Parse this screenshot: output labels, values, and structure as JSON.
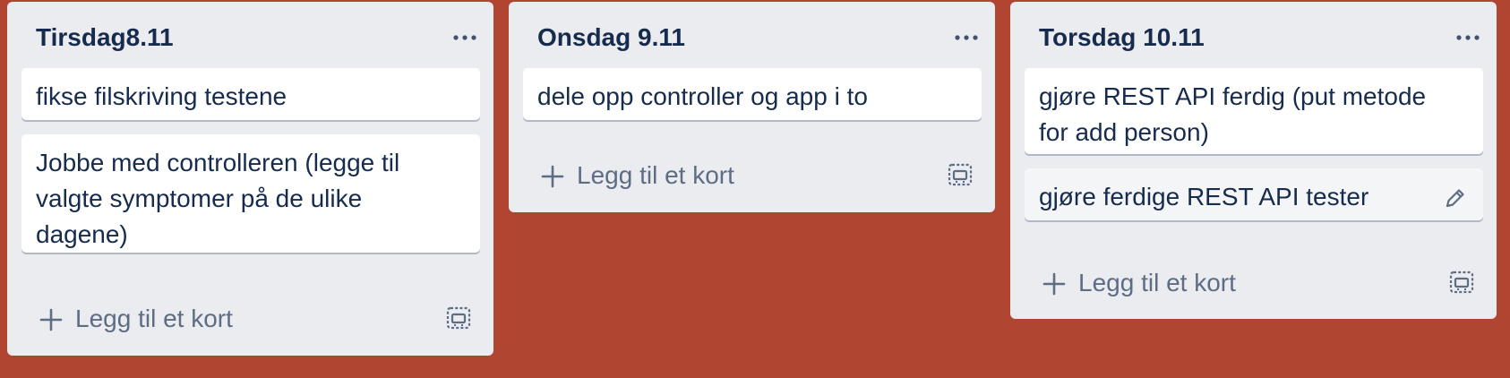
{
  "board": {
    "background_color": "#B04632",
    "lists": [
      {
        "title": "Tirsdag8.11",
        "cards": [
          {
            "text": "fikse filskriving testene"
          },
          {
            "text": "Jobbe med controlleren (legge til valgte symptomer på de ulike dagene)"
          }
        ],
        "add_card_label": "Legg til et kort"
      },
      {
        "title": "Onsdag 9.11",
        "cards": [
          {
            "text": "dele opp controller og app i to"
          }
        ],
        "add_card_label": "Legg til et kort"
      },
      {
        "title": "Torsdag 10.11",
        "cards": [
          {
            "text": "gjøre REST API ferdig (put metode for add person)"
          },
          {
            "text": "gjøre ferdige REST API tester"
          }
        ],
        "add_card_label": "Legg til et kort"
      }
    ]
  },
  "icons": {
    "list_menu": "more-horizontal-icon",
    "add": "plus-icon",
    "template": "card-template-icon",
    "edit": "pencil-edit-icon"
  },
  "colors": {
    "list_bg": "#EBECF0",
    "card_bg": "#FFFFFF",
    "title_text": "#172B4D",
    "muted_text": "#5E6C84"
  }
}
